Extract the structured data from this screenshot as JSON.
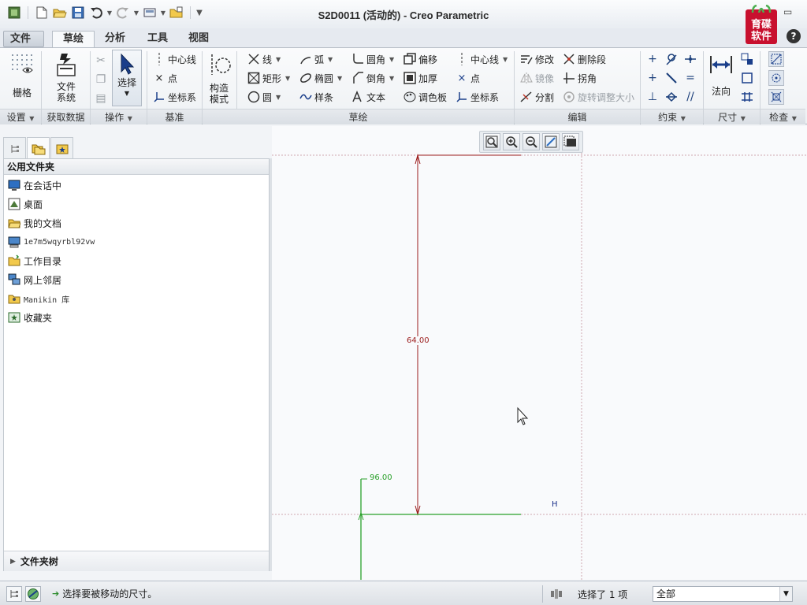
{
  "window": {
    "title": "S2D0011 (活动的) - Creo Parametric",
    "logo_text": [
      "育碟",
      "软件"
    ],
    "help": "?"
  },
  "ribbon_tabs": [
    "文件",
    "草绘",
    "分析",
    "工具",
    "视图"
  ],
  "ribbon_active_tab": "草绘",
  "groups": {
    "setup": {
      "label": "设置",
      "grid": "栅格"
    },
    "get_data": {
      "label": "获取数据",
      "file_system": [
        "文件",
        "系统"
      ]
    },
    "operations": {
      "label": "操作",
      "select": "选择"
    },
    "datum": {
      "label": "基准",
      "centerline": "中心线",
      "point": "点",
      "coord_sys": "坐标系"
    },
    "construct": {
      "label": [
        "构造",
        "模式"
      ]
    },
    "sketch": {
      "label": "草绘",
      "line": "线",
      "arc": "弧",
      "fillet": "圆角",
      "offset": "偏移",
      "centerline": "中心线",
      "rectangle": "矩形",
      "ellipse": "椭圆",
      "chamfer": "倒角",
      "thicken": "加厚",
      "point": "点",
      "circle": "圆",
      "spline": "样条",
      "text": "文本",
      "palette": "调色板",
      "coord_sys": "坐标系"
    },
    "edit": {
      "label": "编辑",
      "modify": "修改",
      "delete_segment": "删除段",
      "mirror": "镜像",
      "corner": "拐角",
      "divide": "分割",
      "rotate_resize": "旋转调整大小"
    },
    "constrain": {
      "label": "约束"
    },
    "dimension": {
      "label": "尺寸",
      "normal": "法向"
    },
    "inspect": {
      "label": "检查"
    }
  },
  "navigator": {
    "header": "公用文件夹",
    "items": [
      {
        "label": "在会话中",
        "icon": "session-icon",
        "mono": false
      },
      {
        "label": "桌面",
        "icon": "desktop-icon",
        "mono": false
      },
      {
        "label": "我的文档",
        "icon": "documents-icon",
        "mono": false
      },
      {
        "label": "1e7m5wqyrbl92vw",
        "icon": "computer-icon",
        "mono": true
      },
      {
        "label": "工作目录",
        "icon": "working-directory-icon",
        "mono": false
      },
      {
        "label": "网上邻居",
        "icon": "network-icon",
        "mono": false
      },
      {
        "label": "Manikin 库",
        "icon": "manikin-library-icon",
        "mono": true
      },
      {
        "label": "收藏夹",
        "icon": "favorites-icon",
        "mono": false
      }
    ],
    "folder_tree": "文件夹树"
  },
  "sketch": {
    "vertical_dimension": "64.00",
    "horizontal_dimension": "96.00",
    "constraint_label": "H"
  },
  "status": {
    "message": "选择要被移动的尺寸。",
    "selection": "选择了 1 项",
    "filter": "全部"
  },
  "colors": {
    "dimension": "#9b1c1c",
    "sketch_line": "#2aa02a",
    "constraint": "#1a2f8a",
    "centerline": "#c0a2a8"
  }
}
